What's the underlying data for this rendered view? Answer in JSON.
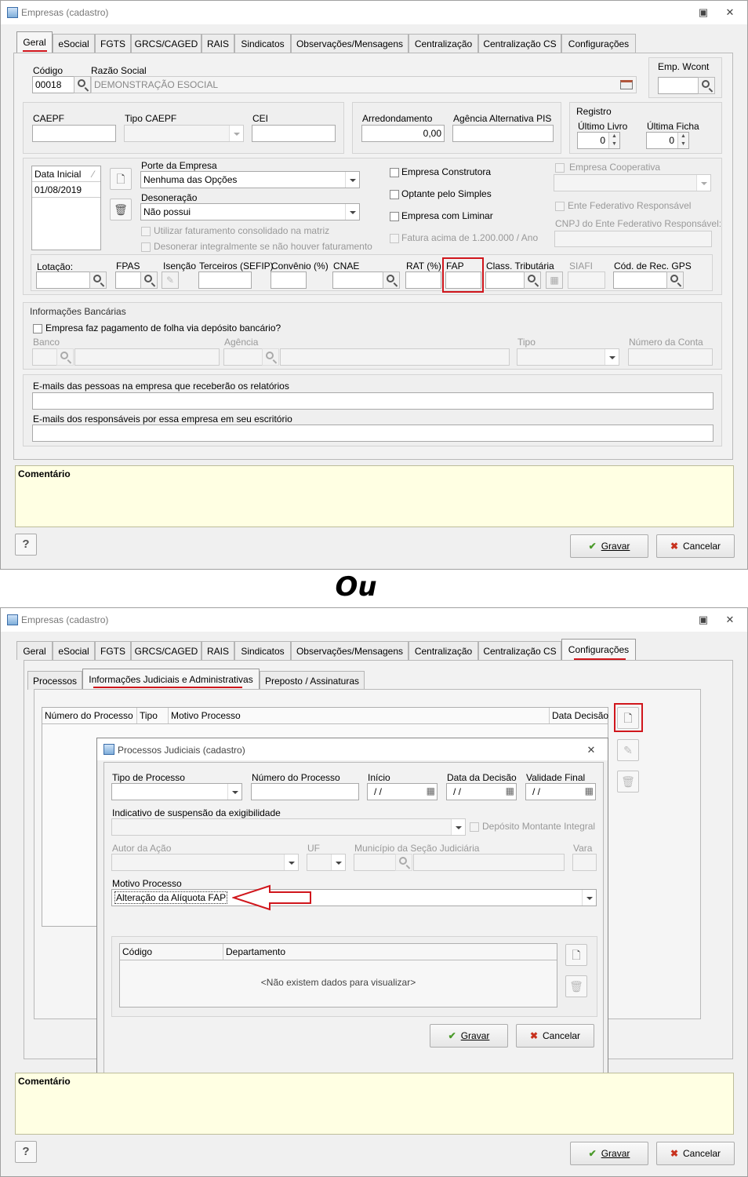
{
  "window1": {
    "title": "Empresas (cadastro)",
    "tabs": [
      "Geral",
      "eSocial",
      "FGTS",
      "GRCS/CAGED",
      "RAIS",
      "Sindicatos",
      "Observações/Mensagens",
      "Centralização",
      "Centralização CS",
      "Configurações"
    ],
    "active_tab": "Geral",
    "codigo_label": "Código",
    "codigo_value": "00018",
    "razao_label": "Razão Social",
    "razao_value": "DEMONSTRAÇÃO ESOCIAL",
    "emp_wcont_label": "Emp. Wcont",
    "caepf_label": "CAEPF",
    "tipo_caepf_label": "Tipo CAEPF",
    "cei_label": "CEI",
    "arred_label": "Arredondamento",
    "arred_value": "0,00",
    "agencia_pis_label": "Agência Alternativa PIS",
    "registro_label": "Registro",
    "ultimo_livro_label": "Último Livro",
    "ultimo_livro_value": "0",
    "ultima_ficha_label": "Última Ficha",
    "ultima_ficha_value": "0",
    "data_inicial_label": "Data Inicial",
    "data_inicial_value": "01/08/2019",
    "porte_label": "Porte da Empresa",
    "porte_value": "Nenhuma das Opções",
    "desoneracao_label": "Desoneração",
    "desoneracao_value": "Não possui",
    "utilizar_fat": "Utilizar faturamento consolidado na matriz",
    "desonerar_int": "Desonerar integralmente se não houver faturamento",
    "empresa_construtora": "Empresa Construtora",
    "optante_simples": "Optante pelo Simples",
    "empresa_liminar": "Empresa com Liminar",
    "fatura_acima": "Fatura acima de 1.200.000 / Ano",
    "empresa_cooperativa": "Empresa Cooperativa",
    "ente_federativo": "Ente Federativo Responsável",
    "cnpj_ente": "CNPJ do Ente Federativo Responsável:",
    "lotacao_label": "Lotação:",
    "fpas_label": "FPAS",
    "isencao_label": "Isenção",
    "terceiros_label": "Terceiros (SEFIP)",
    "convenio_label": "Convênio (%)",
    "cnae_label": "CNAE",
    "rat_label": "RAT (%)",
    "fap_label": "FAP",
    "class_trib_label": "Class. Tributária",
    "siafi_label": "SIAFI",
    "cod_rec_gps_label": "Cód. de Rec. GPS",
    "info_bancarias_label": "Informações Bancárias",
    "pagamento_deposito": "Empresa faz pagamento de folha via depósito bancário?",
    "banco_label": "Banco",
    "agencia_label": "Agência",
    "tipo_label": "Tipo",
    "numero_conta_label": "Número da Conta",
    "emails_pessoas_label": "E-mails das pessoas na empresa que receberão os relatórios",
    "emails_resp_label": "E-mails dos responsáveis por essa empresa em seu escritório",
    "comentario_label": "Comentário",
    "help_label": "?",
    "gravar_label": "Gravar",
    "cancelar_label": "Cancelar"
  },
  "separator_text": "Ou",
  "window2": {
    "title": "Empresas (cadastro)",
    "tabs": [
      "Geral",
      "eSocial",
      "FGTS",
      "GRCS/CAGED",
      "RAIS",
      "Sindicatos",
      "Observações/Mensagens",
      "Centralização",
      "Centralização CS",
      "Configurações"
    ],
    "active_tab": "Configurações",
    "subtabs": [
      "Processos",
      "Informações Judiciais e Administrativas",
      "Preposto / Assinaturas"
    ],
    "grid_columns": [
      "Número do Processo",
      "Tipo",
      "Motivo Processo",
      "Data Decisão"
    ],
    "comentario_label": "Comentário",
    "help_label": "?",
    "gravar_label": "Gravar",
    "cancelar_label": "Cancelar"
  },
  "dialog": {
    "title": "Processos Judiciais (cadastro)",
    "tipo_processo_label": "Tipo de Processo",
    "numero_processo_label": "Número do Processo",
    "inicio_label": "Início",
    "inicio_value": "/ /",
    "data_decisao_label": "Data da Decisão",
    "data_decisao_value": "/ /",
    "validade_final_label": "Validade Final",
    "validade_final_value": "/ /",
    "indicativo_label": "Indicativo de suspensão da exigibilidade",
    "deposito_label": "Depósito Montante Integral",
    "autor_label": "Autor da Ação",
    "uf_label": "UF",
    "municipio_label": "Município da Seção Judiciária",
    "vara_label": "Vara",
    "motivo_label": "Motivo Processo",
    "motivo_value": "Alteração da Alíquota FAP",
    "codigo_col": "Código",
    "departamento_col": "Departamento",
    "empty_text": "<Não existem dados para visualizar>",
    "gravar_label": "Gravar",
    "cancelar_label": "Cancelar"
  },
  "colors": {
    "highlight_red": "#d0161c",
    "comment_bg": "#ffffe3"
  }
}
